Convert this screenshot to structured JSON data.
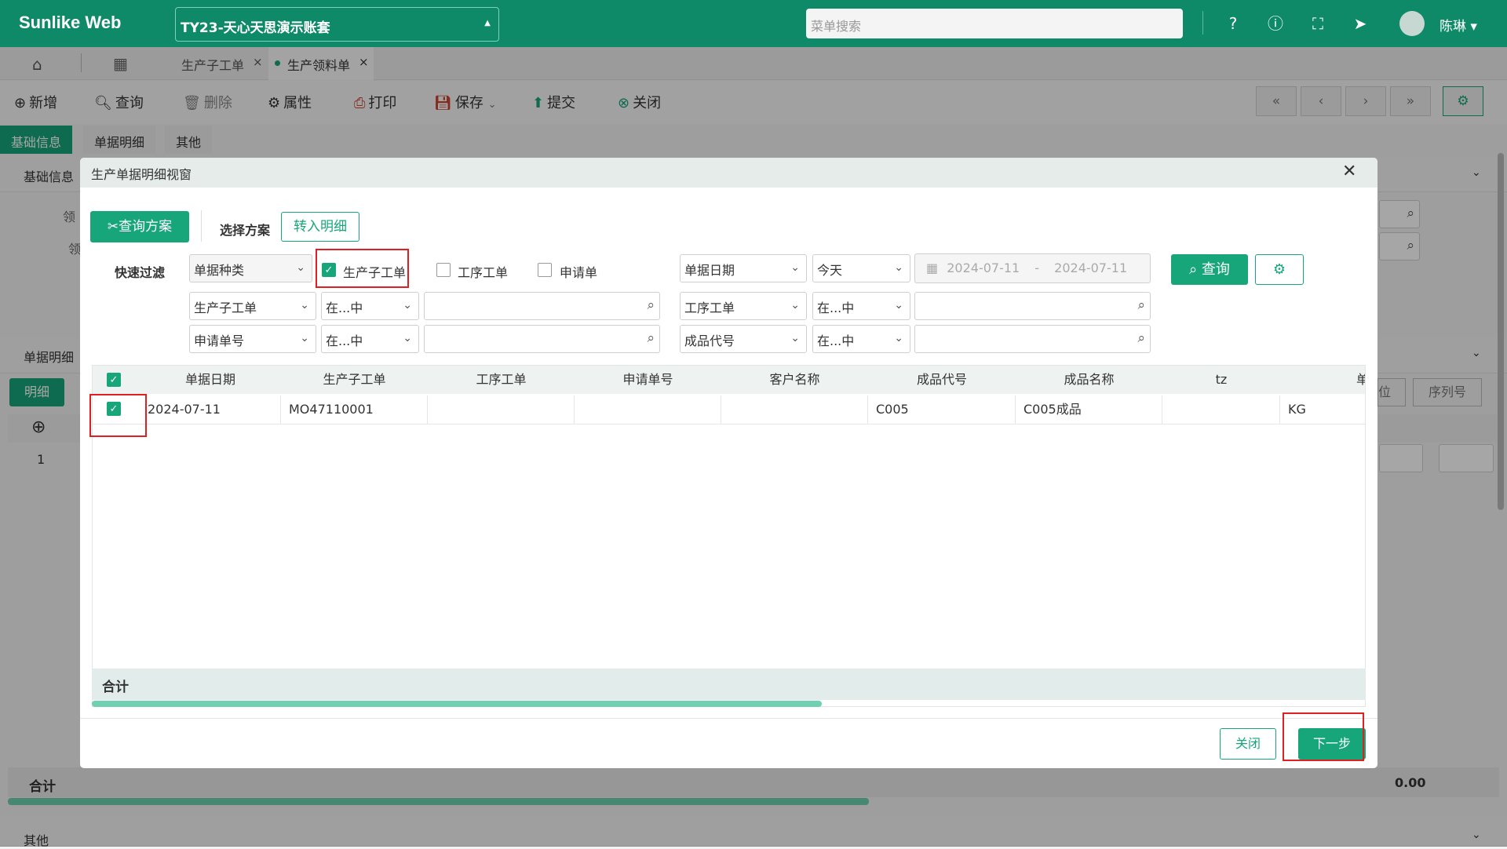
{
  "app": {
    "brand": "Sunlike Web",
    "account": "TY23-天心天思演示账套",
    "search_placeholder": "菜单搜索",
    "user": "陈琳"
  },
  "tabs": [
    {
      "label": "生产子工单"
    },
    {
      "label": "生产领料单"
    }
  ],
  "toolbar": {
    "add": "新增",
    "query": "查询",
    "delete": "删除",
    "props": "属性",
    "print": "打印",
    "save": "保存",
    "submit": "提交",
    "close": "关闭"
  },
  "form_tabs": [
    "基础信息",
    "单据明细",
    "其他"
  ],
  "sections": {
    "basic": "基础信息",
    "detail": "单据明细",
    "detail_tab": "明细",
    "other": "其他",
    "total": "合计",
    "total_value": "0.00",
    "row1": "1",
    "col_unit": "位",
    "col_serial": "序列号",
    "req1": "领",
    "req2": "领"
  },
  "modal": {
    "title": "生产单据明细视窗",
    "query_plan": "查询方案",
    "select_plan": "选择方案",
    "transfer": "转入明细",
    "quick_filter": "快速过滤",
    "doc_type": "单据种类",
    "types": [
      {
        "label": "生产子工单",
        "checked": true
      },
      {
        "label": "工序工单",
        "checked": false
      },
      {
        "label": "申请单",
        "checked": false
      }
    ],
    "date_field": "单据日期",
    "date_preset": "今天",
    "date_from": "2024-07-11",
    "date_sep": "-",
    "date_to": "2024-07-11",
    "query_btn": "查询",
    "filters": {
      "f1_field": "生产子工单",
      "f1_op": "在...中",
      "f2_field": "工序工单",
      "f2_op": "在...中",
      "f3_field": "申请单号",
      "f3_op": "在...中",
      "f4_field": "成品代号",
      "f4_op": "在...中"
    },
    "columns": [
      "单据日期",
      "生产子工单",
      "工序工单",
      "申请单号",
      "客户名称",
      "成品代号",
      "成品名称",
      "tz",
      "单位"
    ],
    "rows": [
      {
        "date": "2024-07-11",
        "mo": "MO47110001",
        "proc": "",
        "req": "",
        "cust": "",
        "code": "C005",
        "name": "C005成品",
        "tz": "",
        "unit": "KG"
      }
    ],
    "total": "合计",
    "close_btn": "关闭",
    "next_btn": "下一步"
  },
  "colors": {
    "primary": "#0f8a68",
    "accent": "#17a57a",
    "highlight": "#e02020"
  }
}
